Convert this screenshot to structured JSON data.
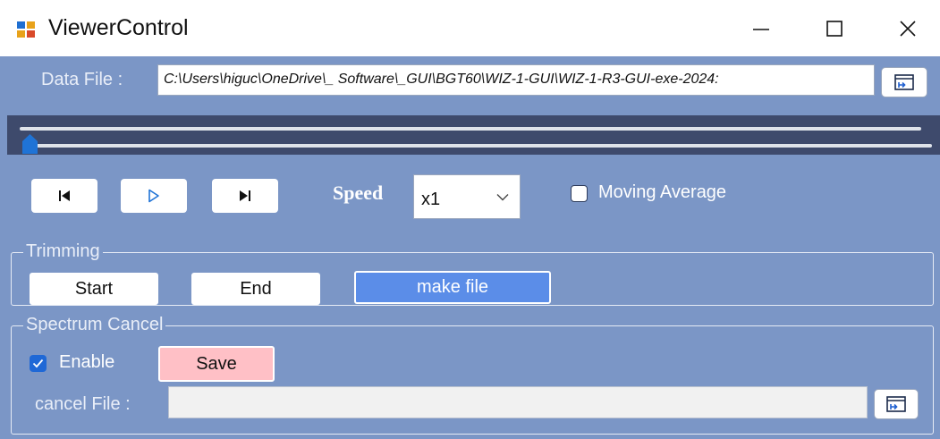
{
  "window": {
    "title": "ViewerControl",
    "icon": "app-window-icon",
    "minimize_glyph": "—",
    "close_glyph": "✕"
  },
  "data_file": {
    "label": "Data File :",
    "value": "C:\\Users\\higuc\\OneDrive\\_ Software\\_GUI\\BGT60\\WIZ-1-GUI\\WIZ-1-R3-GUI-exe-2024:",
    "browse_icon": "browse-folder-icon"
  },
  "playback": {
    "position_fraction": 0.0,
    "prev_icon": "skip-to-start-icon",
    "play_icon": "play-icon",
    "next_icon": "skip-to-end-icon",
    "speed_label": "Speed",
    "speed_value": "x1",
    "moving_average_label": "Moving Average",
    "moving_average_checked": false
  },
  "trimming": {
    "group_title": "Trimming",
    "start_label": "Start",
    "end_label": "End",
    "make_file_label": "make file"
  },
  "spectrum_cancel": {
    "group_title": "Spectrum Cancel",
    "enable_label": "Enable",
    "enable_checked": true,
    "save_label": "Save",
    "cancel_file_label": "cancel File :",
    "cancel_file_value": "",
    "browse_icon": "browse-folder-icon"
  },
  "colors": {
    "background": "#7b96c6",
    "track_background": "#3e4a6c",
    "make_file_button": "#5b8de8",
    "save_button": "#ffc0c6",
    "accent": "#1f68d6"
  }
}
